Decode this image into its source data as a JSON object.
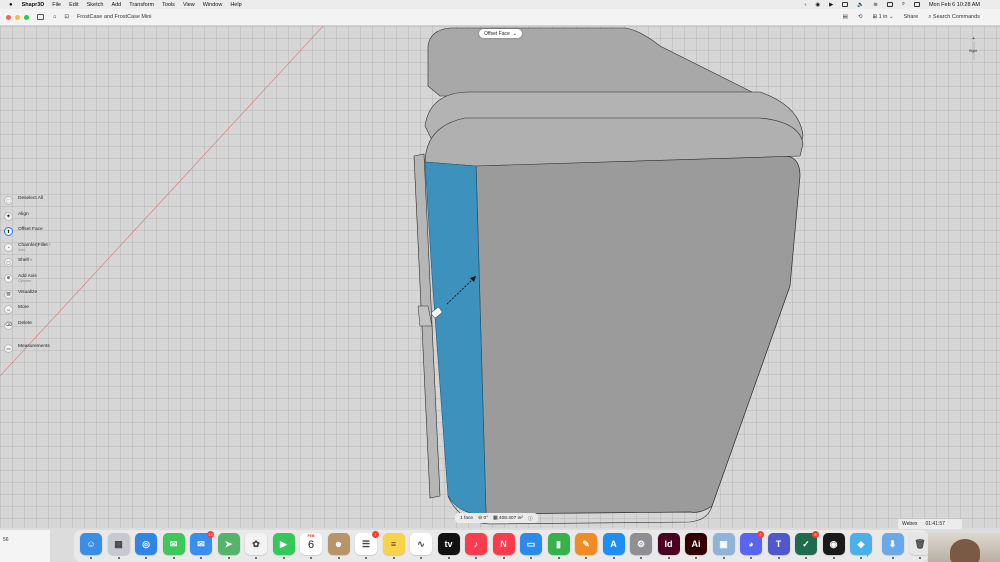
{
  "menubar": {
    "app": "Shapr3D",
    "items": [
      "File",
      "Edit",
      "Sketch",
      "Add",
      "Transform",
      "Tools",
      "View",
      "Window",
      "Help"
    ],
    "clock": "Mon Feb 6  10:28 AM"
  },
  "titlebar": {
    "doc_title": "FrostCase and FrostCase Mini",
    "unit": "1 in",
    "share": "Share",
    "search": "Search Commands"
  },
  "viewport": {
    "context_label": "Offset Face",
    "highlight_color": "#3d91bd",
    "body_color": "#9a9a9a"
  },
  "toolbar": [
    {
      "label": "Deselect All",
      "sub": "",
      "sup": "",
      "icon": "deselect-icon",
      "glyph": "⬚"
    },
    {
      "label": "Align",
      "sub": "",
      "sup": "",
      "icon": "align-icon",
      "glyph": "◈"
    },
    {
      "label": "Offset Face",
      "sub": "",
      "sup": "",
      "icon": "offset-face-icon",
      "glyph": "⬆",
      "active": true
    },
    {
      "label": "Chamfer|Fillet",
      "sub": "Auto",
      "sup": "F",
      "icon": "chamfer-fillet-icon",
      "glyph": "◔"
    },
    {
      "label": "Shell",
      "sub": "",
      "sup": "H",
      "icon": "shell-icon",
      "glyph": "▢"
    },
    {
      "label": "Add Axis",
      "sub": "Cylinder",
      "sup": "",
      "icon": "axis-icon",
      "glyph": "⊕"
    },
    {
      "label": "Visualize",
      "sub": "",
      "sup": "",
      "icon": "visualize-icon",
      "glyph": "▧"
    },
    {
      "label": "More",
      "sub": "",
      "sup": "",
      "icon": "more-icon",
      "glyph": "•••"
    },
    {
      "label": "Delete",
      "sub": "",
      "sup": "",
      "icon": "delete-icon",
      "glyph": "⌫"
    }
  ],
  "measurements": "Measurements",
  "compass": {
    "label": "Right"
  },
  "status": {
    "selection": "1 face",
    "angle": "0°",
    "area": "408.407 in²"
  },
  "webex": {
    "app": "Webex",
    "timer": "01:41:57"
  },
  "left_strip": {
    "label": "56"
  },
  "dock": {
    "calendar_month": "FEB",
    "calendar_day": "6",
    "items": [
      {
        "name": "finder",
        "color": "#3a8ee6",
        "glyph": "☺",
        "badge": ""
      },
      {
        "name": "launchpad",
        "color": "#c8c8d0",
        "glyph": "▦",
        "badge": ""
      },
      {
        "name": "safari",
        "color": "#2f84e6",
        "glyph": "◎",
        "badge": ""
      },
      {
        "name": "messages",
        "color": "#3cc85a",
        "glyph": "✉",
        "badge": ""
      },
      {
        "name": "mail",
        "color": "#3a8ef0",
        "glyph": "✉",
        "badge": "14"
      },
      {
        "name": "maps",
        "color": "#55b36b",
        "glyph": "➤",
        "badge": ""
      },
      {
        "name": "photos",
        "color": "#f3f3f3",
        "glyph": "✿",
        "badge": ""
      },
      {
        "name": "facetime",
        "color": "#35c759",
        "glyph": "▶",
        "badge": ""
      },
      {
        "name": "calendar",
        "color": "#ffffff",
        "glyph": "",
        "badge": ""
      },
      {
        "name": "contacts",
        "color": "#b89468",
        "glyph": "☻",
        "badge": ""
      },
      {
        "name": "reminders",
        "color": "#ffffff",
        "glyph": "☰",
        "badge": "1"
      },
      {
        "name": "notes",
        "color": "#f7d34a",
        "glyph": "≡",
        "badge": ""
      },
      {
        "name": "freeform",
        "color": "#ffffff",
        "glyph": "∿",
        "badge": ""
      },
      {
        "name": "apple-tv",
        "color": "#111111",
        "glyph": "tv",
        "badge": ""
      },
      {
        "name": "music",
        "color": "#fa3c4f",
        "glyph": "♪",
        "badge": ""
      },
      {
        "name": "news",
        "color": "#fa3b4b",
        "glyph": "N",
        "badge": ""
      },
      {
        "name": "keynote",
        "color": "#2d8ae8",
        "glyph": "▭",
        "badge": ""
      },
      {
        "name": "numbers",
        "color": "#35b34a",
        "glyph": "▮",
        "badge": ""
      },
      {
        "name": "pages",
        "color": "#f08c21",
        "glyph": "✎",
        "badge": ""
      },
      {
        "name": "app-store",
        "color": "#1f8ef3",
        "glyph": "A",
        "badge": ""
      },
      {
        "name": "system-settings",
        "color": "#8e8e93",
        "glyph": "⚙",
        "badge": ""
      },
      {
        "name": "indesign",
        "color": "#49021f",
        "glyph": "Id",
        "badge": ""
      },
      {
        "name": "illustrator",
        "color": "#330000",
        "glyph": "Ai",
        "badge": ""
      },
      {
        "name": "preview",
        "color": "#8fb4d8",
        "glyph": "▣",
        "badge": ""
      },
      {
        "name": "discord",
        "color": "#5865f2",
        "glyph": "◕",
        "badge": "2"
      },
      {
        "name": "teams",
        "color": "#5059c9",
        "glyph": "T",
        "badge": ""
      },
      {
        "name": "tasks",
        "color": "#1e6b4f",
        "glyph": "✓",
        "badge": "8"
      },
      {
        "name": "webex",
        "color": "#1a1a1a",
        "glyph": "◉",
        "badge": ""
      },
      {
        "name": "shapr3d",
        "color": "#4ab0e8",
        "glyph": "◆",
        "badge": ""
      },
      {
        "name": "downloads",
        "color": "#6aa8e6",
        "glyph": "⬇",
        "badge": ""
      },
      {
        "name": "trash",
        "color": "#e6e6e6",
        "glyph": "🗑",
        "badge": ""
      }
    ]
  }
}
